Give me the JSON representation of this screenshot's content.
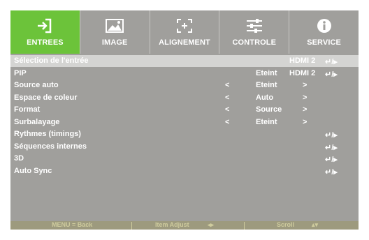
{
  "tabs": [
    {
      "label": "ENTREES",
      "icon": "input-icon",
      "active": true
    },
    {
      "label": "IMAGE",
      "icon": "image-icon",
      "active": false
    },
    {
      "label": "ALIGNEMENT",
      "icon": "alignment-icon",
      "active": false
    },
    {
      "label": "CONTROLE",
      "icon": "sliders-icon",
      "active": false
    },
    {
      "label": "SERVICE",
      "icon": "info-icon",
      "active": false
    }
  ],
  "menu": [
    {
      "name": "Sélection de l'entrée",
      "hdmi": "HDMI 2",
      "enter": "↵/▸"
    },
    {
      "name": "PIP",
      "value": "Eteint",
      "hdmi": "HDMI 2",
      "enter": "↵/▸"
    },
    {
      "name": "Source auto",
      "lt": "<",
      "value": "Eteint",
      "gt": ">"
    },
    {
      "name": "Espace de coleur",
      "lt": "<",
      "value": "Auto",
      "gt": ">"
    },
    {
      "name": "Format",
      "lt": "<",
      "value": "Source",
      "gt": ">"
    },
    {
      "name": "Surbalayage",
      "lt": "<",
      "value": "Eteint",
      "gt": ">"
    },
    {
      "name": "Rythmes (timings)",
      "enter": "↵/▸"
    },
    {
      "name": "Séquences internes",
      "enter": "↵/▸"
    },
    {
      "name": "3D",
      "enter": "↵/▸"
    },
    {
      "name": "Auto Sync",
      "enter": "↵/▸"
    }
  ],
  "footer": {
    "back": "MENU = Back",
    "adjust": "Item  Adjust",
    "adjust_arrows": "◂▸",
    "scroll": "Scroll",
    "scroll_arrows": "▴▾"
  },
  "colors": {
    "active_tab": "#6cc33a",
    "panel": "#a09f9c",
    "highlight": "#d4d4d2",
    "footer": "#9d9a7e"
  }
}
